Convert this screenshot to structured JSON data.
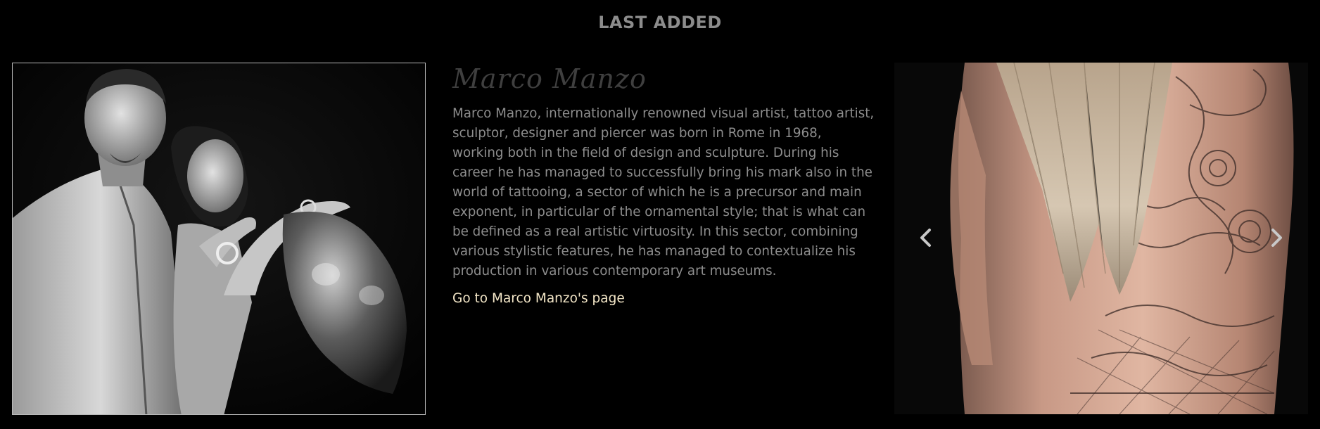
{
  "section": {
    "title": "LAST ADDED"
  },
  "artist": {
    "name": "Marco Manzo",
    "bio": "Marco Manzo, internationally renowned visual artist, tattoo artist, sculptor, designer and piercer was born in Rome in 1968, working both in the field of design and sculpture. During his career he has managed to successfully bring his mark also in the world of tattooing, a sector of which he is a precursor and main exponent, in particular of the ornamental style; that is what can be defined as a real artistic virtuosity. In this sector, combining various stylistic features, he has managed to contextualize his production in various contemporary art museums.",
    "link_label": "Go to Marco Manzo's page"
  },
  "carousel": {
    "prev_icon": "chevron-left-icon",
    "next_icon": "chevron-right-icon"
  },
  "colors": {
    "background": "#000000",
    "title": "#8c8c8c",
    "body_text": "#8d8d8d",
    "name": "#3f3f3f",
    "link": "#f3e6c7",
    "photo_border": "#b9b9b9"
  }
}
